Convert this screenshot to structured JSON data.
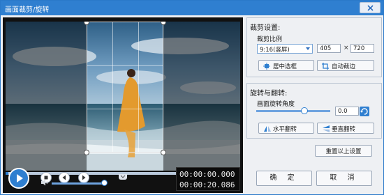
{
  "window": {
    "title": "画面裁剪/旋转"
  },
  "player": {
    "time_current": "00:00:00.000",
    "time_total": "00:00:20.086"
  },
  "crop": {
    "section_title": "裁剪设置:",
    "ratio_label": "裁剪比例",
    "ratio_value": "9:16(竖屏)",
    "width": "405",
    "times": "×",
    "height": "720",
    "center_button": "居中选框",
    "auto_button": "自动截边"
  },
  "rotate": {
    "section_title": "旋转与翻转:",
    "angle_label": "画面旋转角度",
    "angle_value": "0.0",
    "flip_h_button": "水平翻转",
    "flip_v_button": "垂直翻转"
  },
  "reset_button": "重置以上设置",
  "ok_button": "确 定",
  "cancel_button": "取 消",
  "icons": [
    "close-icon",
    "play-icon",
    "stop-icon",
    "prev-icon",
    "next-icon",
    "volume-icon",
    "center-icon",
    "autocrop-icon",
    "rotate-icon",
    "flip-h-icon",
    "flip-v-icon"
  ]
}
